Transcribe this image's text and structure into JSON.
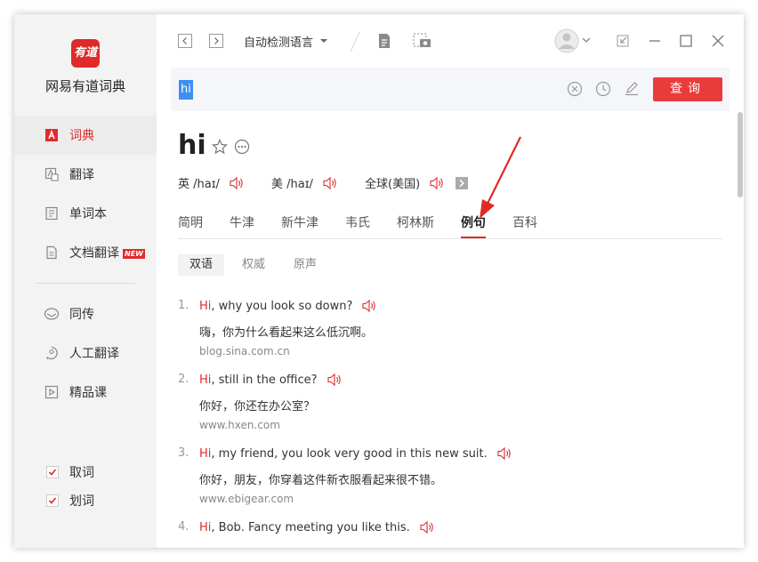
{
  "app": {
    "logo_text": "有道",
    "name": "网易有道词典"
  },
  "sidebar": {
    "items": [
      {
        "label": "词典",
        "icon": "dict-icon"
      },
      {
        "label": "翻译",
        "icon": "translate-icon"
      },
      {
        "label": "单词本",
        "icon": "wordbook-icon"
      },
      {
        "label": "文档翻译",
        "icon": "document-icon",
        "badge": "NEW"
      },
      {
        "label": "同传",
        "icon": "simultaneous-icon"
      },
      {
        "label": "人工翻译",
        "icon": "human-translate-icon"
      },
      {
        "label": "精品课",
        "icon": "course-icon"
      }
    ],
    "checks": [
      {
        "label": "取词",
        "checked": true
      },
      {
        "label": "划词",
        "checked": true
      }
    ]
  },
  "toolbar": {
    "language": "自动检测语言"
  },
  "search": {
    "query": "hi",
    "button": "查询"
  },
  "entry": {
    "word": "hi",
    "pronunciations": [
      {
        "label": "英 /haɪ/"
      },
      {
        "label": "美 /haɪ/"
      },
      {
        "label": "全球(美国)"
      }
    ]
  },
  "tabs": [
    "简明",
    "牛津",
    "新牛津",
    "韦氏",
    "柯林斯",
    "例句",
    "百科"
  ],
  "active_tab": "例句",
  "subtabs": [
    "双语",
    "权威",
    "原声"
  ],
  "examples": [
    {
      "num": "1.",
      "keyword": "Hi",
      "rest": ", why you look so down?",
      "cn": "嗨，你为什么看起来这么低沉啊。",
      "src": "blog.sina.com.cn"
    },
    {
      "num": "2.",
      "keyword": "Hi",
      "rest": ", still in the office?",
      "cn": "你好，你还在办公室？",
      "src": "www.hxen.com"
    },
    {
      "num": "3.",
      "keyword": "Hi",
      "rest": ", my friend, you look very good in this new suit.",
      "cn": "你好，朋友，你穿着这件新衣服看起来很不错。",
      "src": "www.ebigear.com"
    },
    {
      "num": "4.",
      "keyword": "Hi",
      "rest": ", Bob. Fancy meeting you like this.",
      "cn": "",
      "src": ""
    }
  ],
  "colors": {
    "accent": "#e02a2a",
    "button": "#ea3b3b",
    "selection": "#3d8ff2",
    "sidebar_bg": "#f3f3f3"
  }
}
